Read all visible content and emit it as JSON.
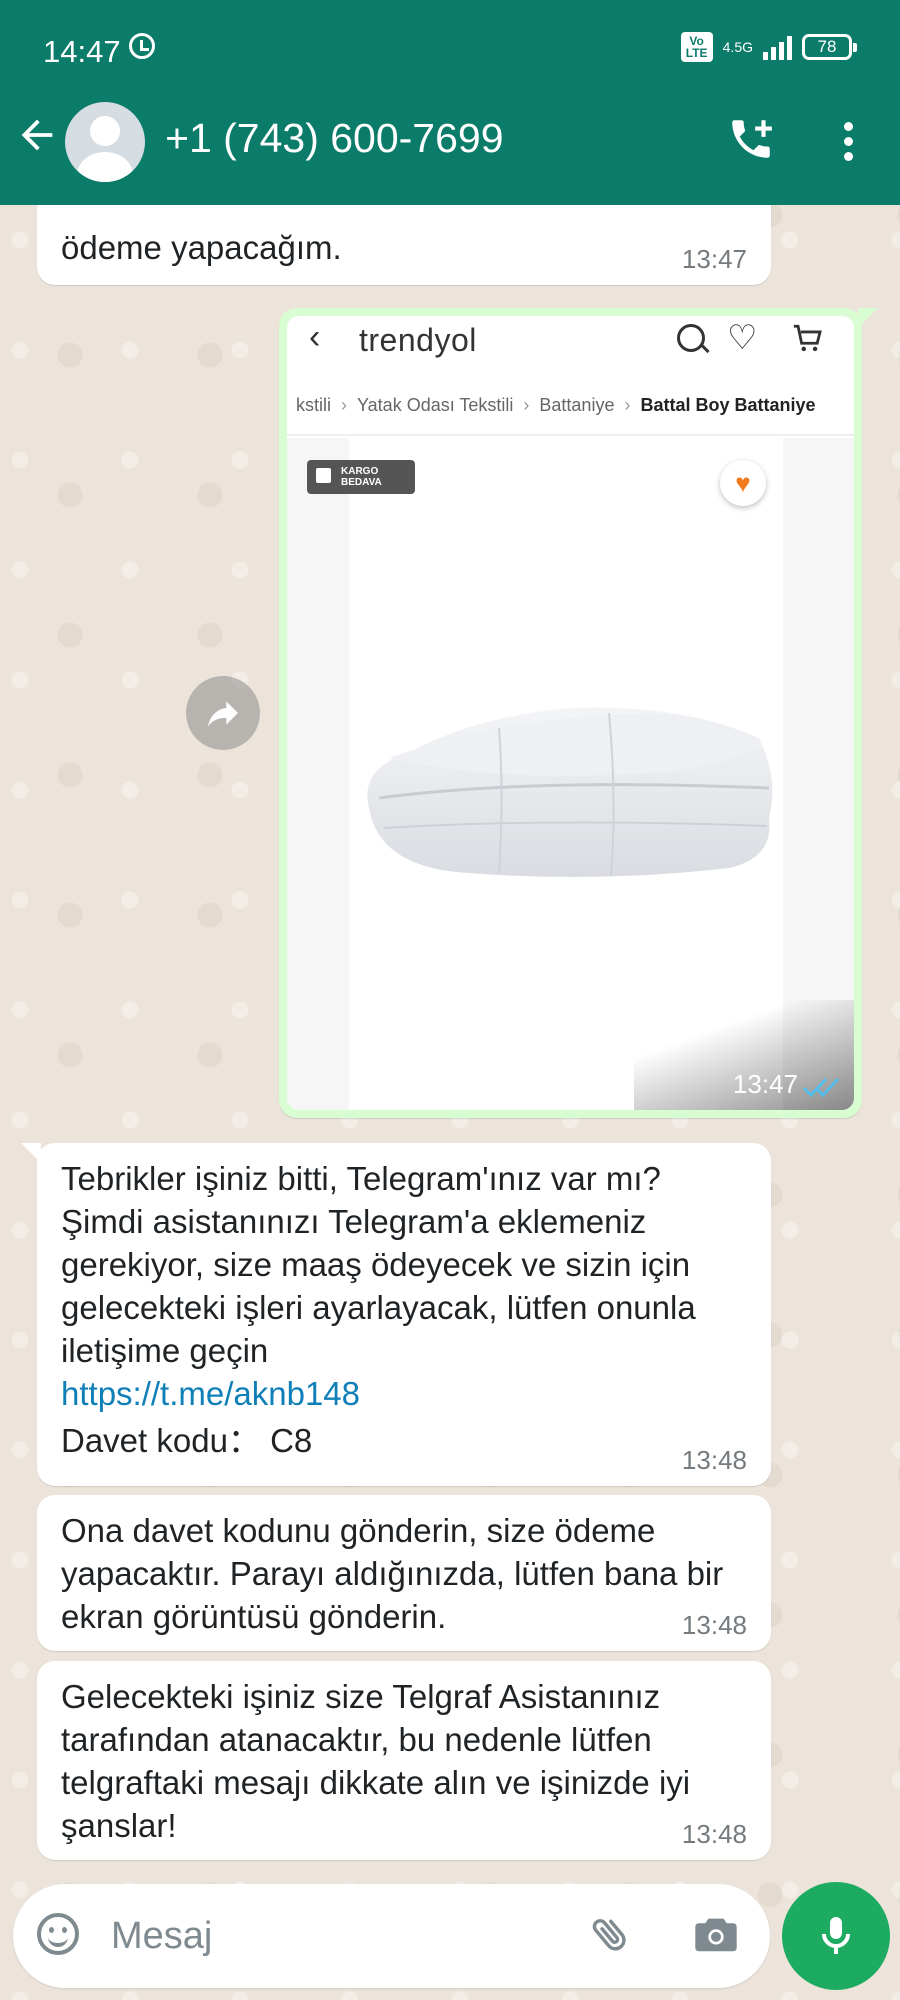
{
  "status_bar": {
    "time": "14:47",
    "volte": "Vo LTE",
    "network": "4.5G",
    "battery": "78"
  },
  "header": {
    "contact_name": "+1 (743) 600-7699",
    "icons": [
      "back-arrow-icon",
      "avatar",
      "add-call-icon",
      "more-vert-icon"
    ]
  },
  "messages": [
    {
      "direction": "incoming",
      "text": "Bu son görev, tamamlandığında sana ödeme yapacağım.",
      "visible_text": "ödeme yapacağım.",
      "time": "13:47"
    },
    {
      "direction": "outgoing",
      "type": "image",
      "time": "13:47",
      "status": "read",
      "screenshot": {
        "logo": "trendyol",
        "breadcrumb": [
          "kstili",
          "Yatak Odası Tekstili",
          "Battaniye",
          "Battal Boy Battaniye"
        ],
        "badge": "KARGO BEDAVA"
      }
    },
    {
      "direction": "incoming",
      "text": "Tebrikler işiniz bitti, Telegram'ınız var mı? Şimdi asistanınızı Telegram'a eklemeniz gerekiyor, size maaş ödeyecek ve sizin için gelecekteki işleri ayarlayacak, lütfen onunla iletişime geçin",
      "link": "https://t.me/aknb148",
      "invite": "Davet kodu： C8",
      "time": "13:48"
    },
    {
      "direction": "incoming",
      "text": "Ona davet kodunu gönderin, size ödeme yapacaktır. Parayı aldığınızda, lütfen bana bir ekran görüntüsü gönderin.",
      "time": "13:48"
    },
    {
      "direction": "incoming",
      "text": "Gelecekteki işiniz size Telgraf Asistanınız tarafından atanacaktır, bu nedenle lütfen telgraftaki mesajı dikkate alın ve işinizde iyi şanslar!",
      "time": "13:48"
    }
  ],
  "composer": {
    "placeholder": "Mesaj",
    "value": ""
  },
  "colors": {
    "header": "#0b7b6a",
    "outgoing_bubble": "#d9fdd3",
    "incoming_bubble": "#ffffff",
    "mic_button": "#1daa61",
    "link": "#0f7fb8",
    "read_ticks": "#53bdeb",
    "trendyol_orange": "#f27a1a"
  }
}
